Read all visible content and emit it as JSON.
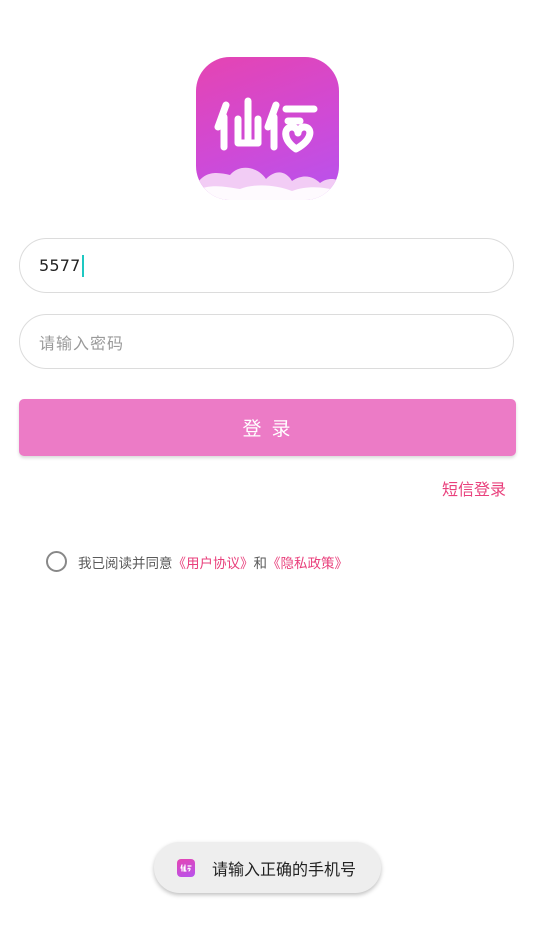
{
  "app": {
    "logo_text": "仙侣",
    "icon": "app-logo-icon",
    "brand_color": "#e544b2"
  },
  "login_form": {
    "phone_value": "5577",
    "password_placeholder": "请输入密码",
    "login_button_label": "登 录",
    "sms_login_label": "短信登录"
  },
  "agreement": {
    "checked": false,
    "prefix": "我已阅读并同意",
    "user_agreement": "《用户协议》",
    "conjunction": "和",
    "privacy_policy": "《隐私政策》"
  },
  "toast": {
    "message": "请输入正确的手机号",
    "icon": "app-logo-icon"
  },
  "colors": {
    "accent": "#e9407c",
    "button": "#ec7bc6",
    "caret": "#1ec8c2"
  }
}
